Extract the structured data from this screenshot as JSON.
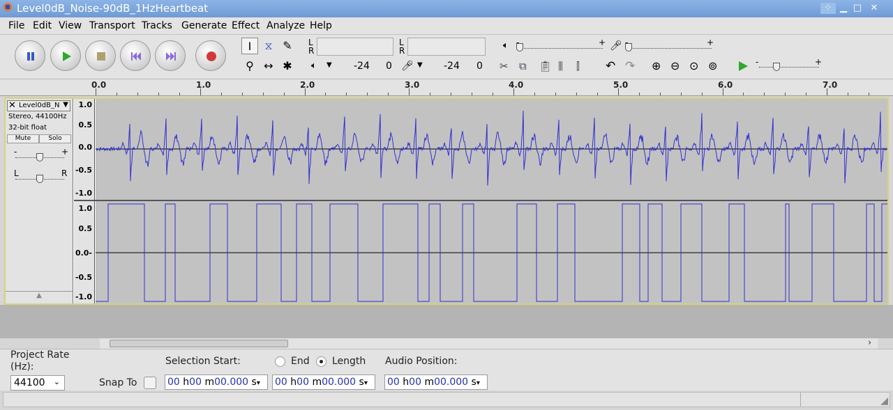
{
  "window": {
    "title": "Level0dB_Noise-90dB_1HzHeartbeat"
  },
  "menu": [
    "File",
    "Edit",
    "View",
    "Transport",
    "Tracks",
    "Generate",
    "Effect",
    "Analyze",
    "Help"
  ],
  "meters": {
    "left": "L",
    "right": "R",
    "play_lo": "-24",
    "play_hi": "0",
    "rec_lo": "-24",
    "rec_hi": "0"
  },
  "slider_signs": {
    "minus": "-",
    "plus": "+"
  },
  "ruler": {
    "labels": [
      "0.0",
      "1.0",
      "2.0",
      "3.0",
      "4.0",
      "5.0",
      "6.0",
      "7.0"
    ]
  },
  "track": {
    "name": "Level0dB_N",
    "format": "Stereo, 44100Hz",
    "bitdepth": "32-bit float",
    "mute": "Mute",
    "solo": "Solo",
    "pan_left": "L",
    "pan_right": "R",
    "scale": [
      "1.0",
      "0.5",
      "0.0-",
      "-0.5",
      "-1.0"
    ],
    "scale_top": [
      "1.0",
      "0.5",
      "0.0",
      "-0.5",
      "-1.0"
    ]
  },
  "selection": {
    "project_rate_label": "Project Rate (Hz):",
    "project_rate": "44100",
    "snap_label": "Snap To",
    "sel_start_label": "Selection Start:",
    "end_label": "End",
    "length_label": "Length",
    "audio_pos_label": "Audio Position:",
    "tc_h": "00",
    "tc_m": "00",
    "tc_s": "00.000",
    "u_h": "h",
    "u_m": "m",
    "u_s": "s"
  },
  "colors": {
    "wave": "#3030d0",
    "square": "#3030d0",
    "title_bg": "#7aa3dd"
  }
}
